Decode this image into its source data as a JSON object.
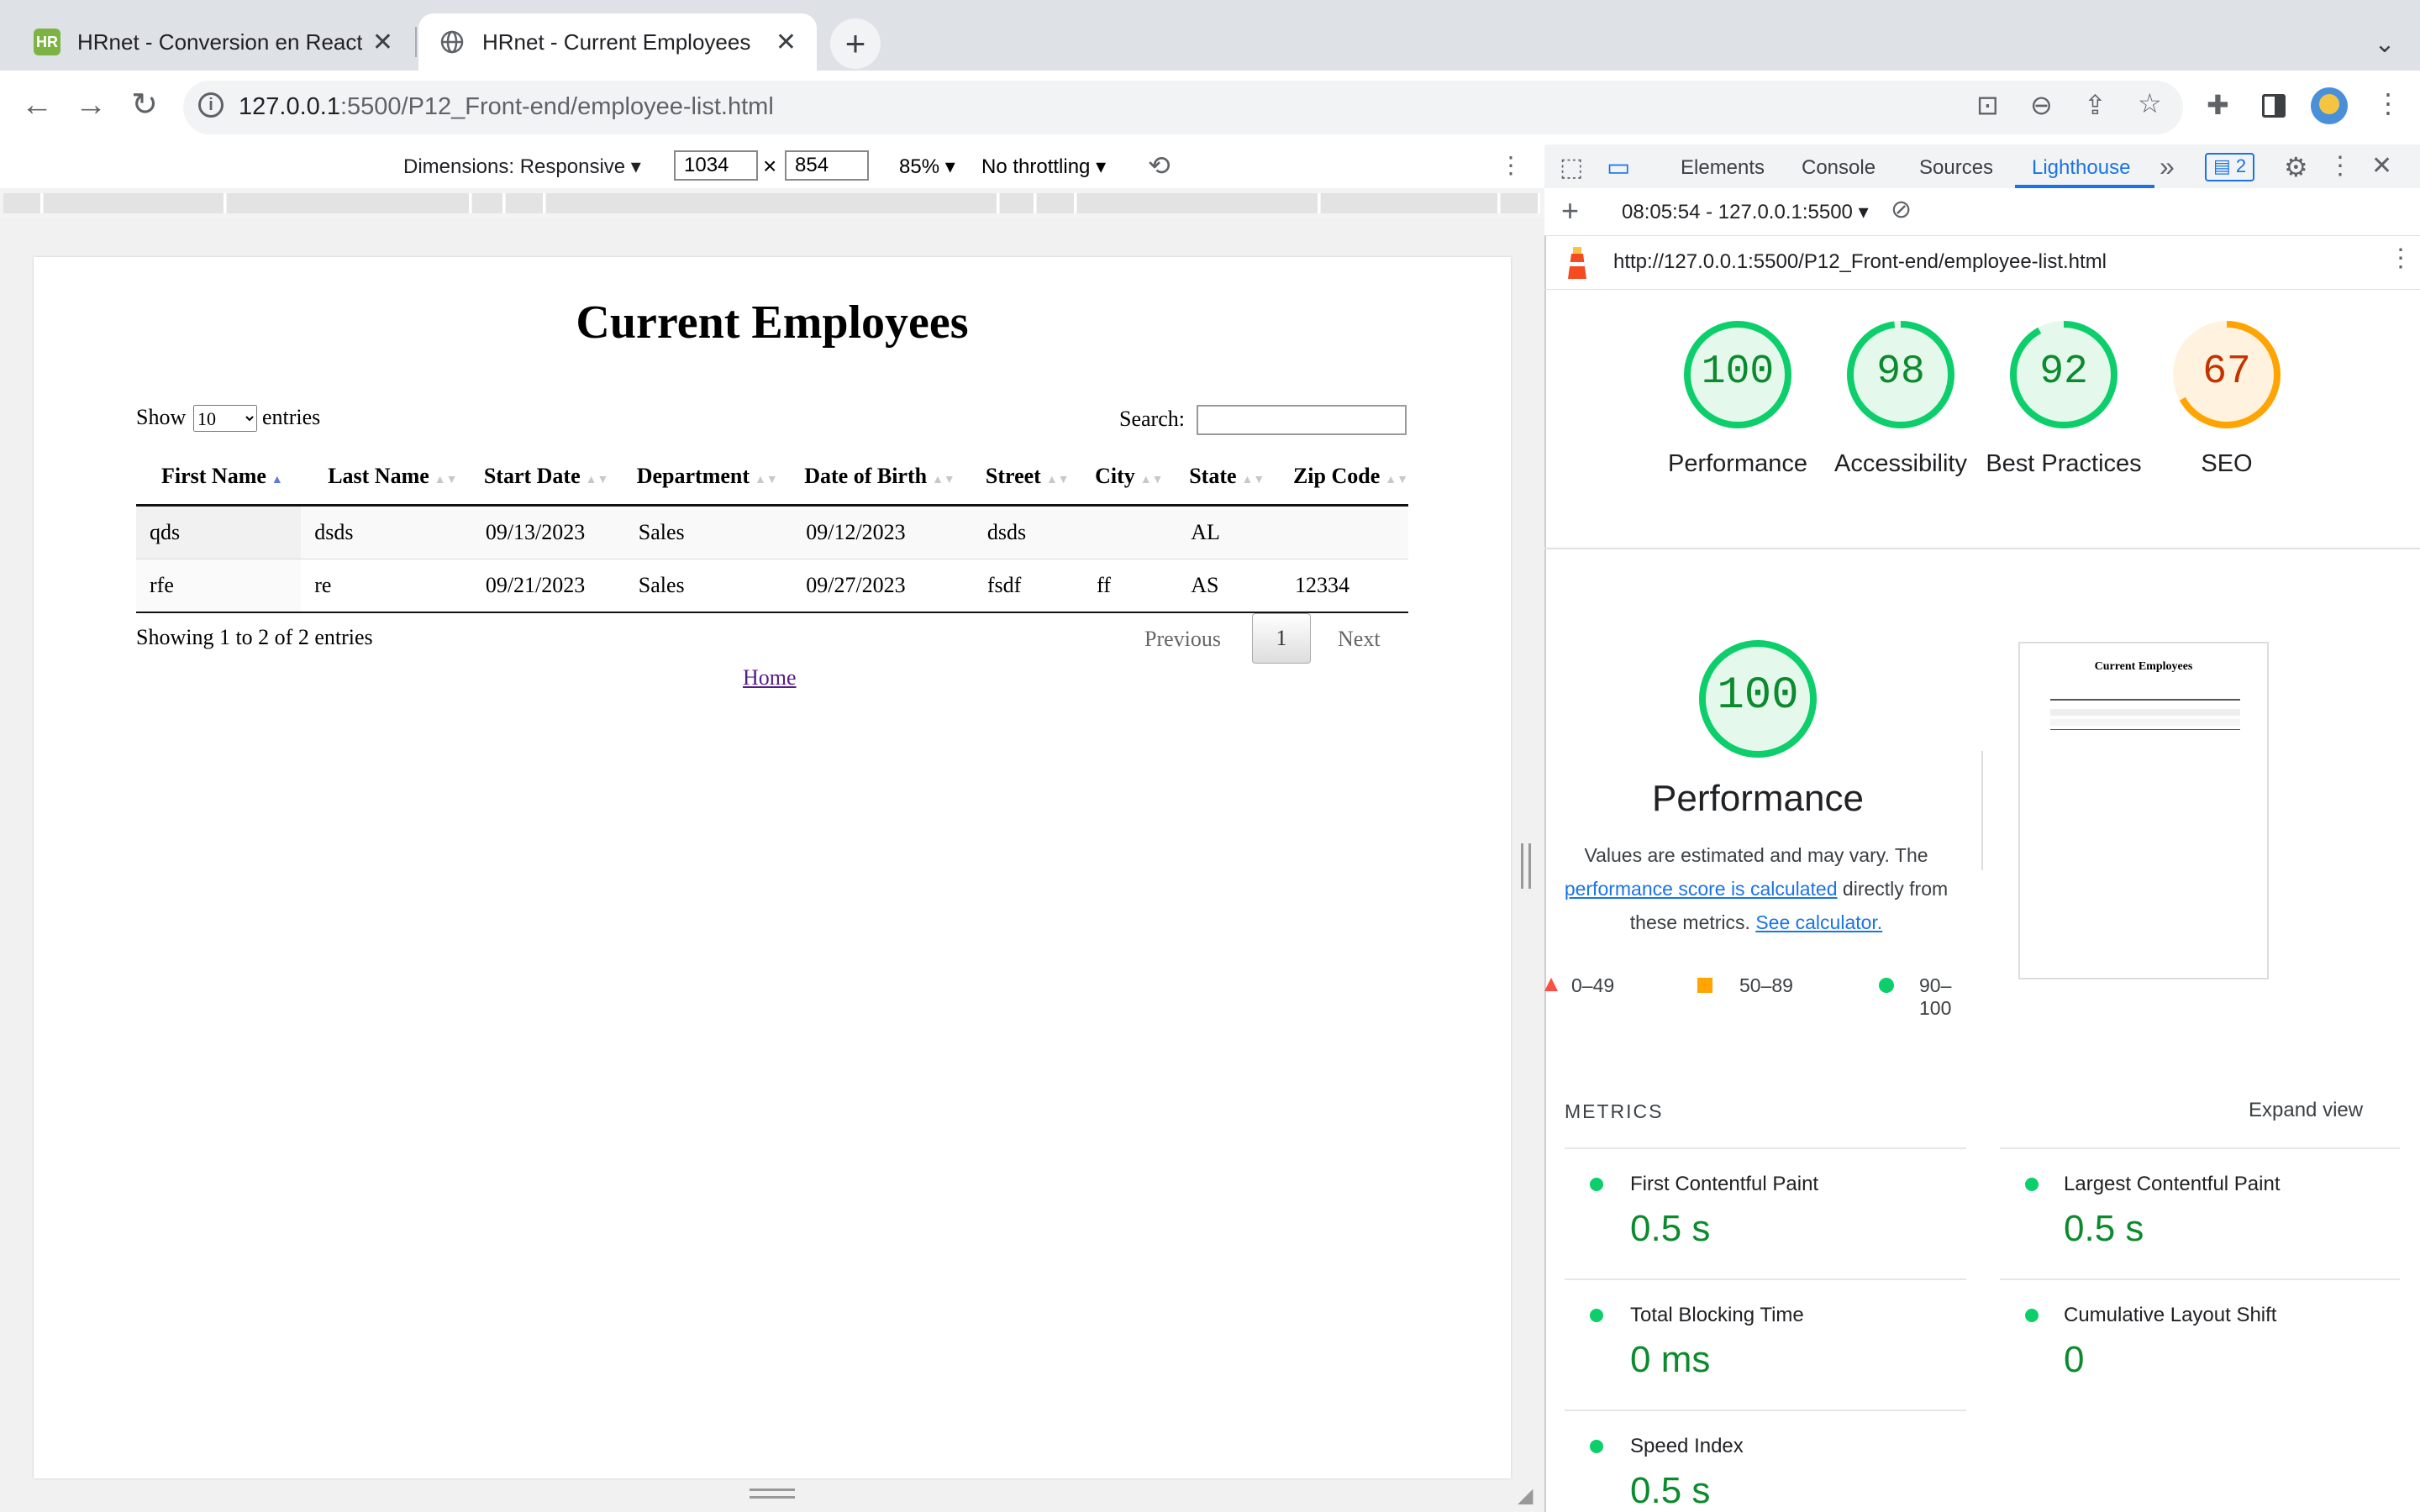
{
  "tabs": [
    {
      "title": "HRnet - Conversion en React",
      "favicon_text": "HR",
      "favicon_color": "#7cb342",
      "active": false
    },
    {
      "title": "HRnet - Current Employees",
      "active": true
    }
  ],
  "toolbar": {
    "url_host": "127.0.0.1",
    "url_rest": ":5500/P12_Front-end/employee-list.html"
  },
  "device_toolbar": {
    "dimensions_label": "Dimensions: Responsive",
    "width": "1034",
    "times": "×",
    "height": "854",
    "zoom": "85%",
    "throttling": "No throttling"
  },
  "page": {
    "title": "Current Employees",
    "show_label": "Show",
    "entries_label": "entries",
    "page_length": "10",
    "search_label": "Search:",
    "columns": [
      "First Name",
      "Last Name",
      "Start Date",
      "Department",
      "Date of Birth",
      "Street",
      "City",
      "State",
      "Zip Code"
    ],
    "rows": [
      [
        "qds",
        "dsds",
        "09/13/2023",
        "Sales",
        "09/12/2023",
        "dsds",
        "",
        "AL",
        ""
      ],
      [
        "rfe",
        "re",
        "09/21/2023",
        "Sales",
        "09/27/2023",
        "fsdf",
        "ff",
        "AS",
        "12334"
      ]
    ],
    "info": "Showing 1 to 2 of 2 entries",
    "previous": "Previous",
    "current_page": "1",
    "next": "Next",
    "home_link": "Home"
  },
  "devtools": {
    "tabs": [
      "Elements",
      "Console",
      "Sources",
      "Lighthouse"
    ],
    "more": "»",
    "issues_count": "2",
    "report_select": "08:05:54 - 127.0.0.1:5500",
    "report_url": "http://127.0.0.1:5500/P12_Front-end/employee-list.html",
    "scores": [
      {
        "label": "Performance",
        "value": "100",
        "color": "#0cce6b",
        "text_color": "#0c8a2e",
        "fraction": 1.0
      },
      {
        "label": "Accessibility",
        "value": "98",
        "color": "#0cce6b",
        "text_color": "#0c8a2e",
        "fraction": 0.98
      },
      {
        "label": "Best Practices",
        "value": "92",
        "color": "#0cce6b",
        "text_color": "#0c8a2e",
        "fraction": 0.92
      },
      {
        "label": "SEO",
        "value": "67",
        "color": "#ffa400",
        "text_color": "#c33300",
        "fraction": 0.67
      }
    ],
    "perf_big": {
      "value": "100",
      "title": "Performance",
      "desc_1": "Values are estimated and may vary. The",
      "link_1": "performance score is calculated",
      "desc_2": "directly from",
      "desc_3": "these metrics.",
      "link_2": "See calculator."
    },
    "legend": [
      "0–49",
      "50–89",
      "90–100"
    ],
    "metrics_heading": "METRICS",
    "expand_view": "Expand view",
    "metrics": [
      {
        "name": "First Contentful Paint",
        "value": "0.5 s"
      },
      {
        "name": "Largest Contentful Paint",
        "value": "0.5 s"
      },
      {
        "name": "Total Blocking Time",
        "value": "0 ms"
      },
      {
        "name": "Cumulative Layout Shift",
        "value": "0"
      },
      {
        "name": "Speed Index",
        "value": "0.5 s"
      }
    ],
    "thumb": {
      "title": "Current Employees"
    }
  }
}
